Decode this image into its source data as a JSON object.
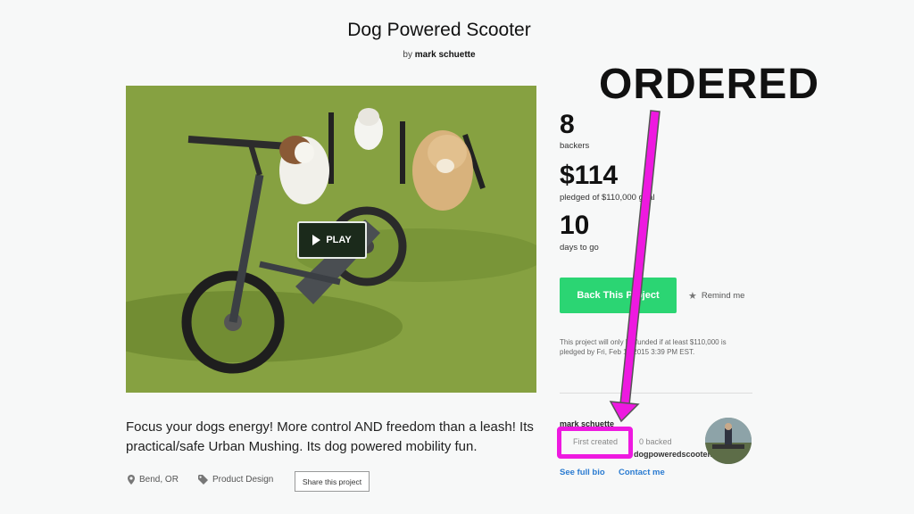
{
  "project": {
    "title": "Dog Powered Scooter",
    "by_prefix": "by",
    "creator": "mark schuette",
    "blurb": "Focus your dogs energy! More control AND freedom than a leash! Its practical/safe Urban Mushing. Its dog powered mobility fun.",
    "location": "Bend, OR",
    "category": "Product Design",
    "share_label": "Share this project"
  },
  "video": {
    "play_label": "PLAY"
  },
  "stats": {
    "backers_count": "8",
    "backers_label": "backers",
    "pledged_amount": "$114",
    "pledged_label": "pledged of $110,000 goal",
    "days_count": "10",
    "days_label": "days to go"
  },
  "actions": {
    "back_label": "Back This Project",
    "remind_label": "Remind me"
  },
  "funding_note": "This project will only be funded if at least $110,000 is pledged by Fri, Feb 13 2015 3:39 PM EST.",
  "creator_box": {
    "name": "mark schuette",
    "first_created": "First created",
    "backed": "0 backed",
    "website": "dogpoweredscooter.com",
    "see_bio": "See full bio",
    "contact": "Contact me"
  },
  "annotation": {
    "text": "ORDERED",
    "color": "#ee19e0"
  },
  "colors": {
    "back_button": "#2bd573",
    "link": "#2a7bd1",
    "highlight": "#ee19e0"
  },
  "icons": [
    "location-pin-icon",
    "tag-icon",
    "star-icon",
    "play-icon"
  ]
}
